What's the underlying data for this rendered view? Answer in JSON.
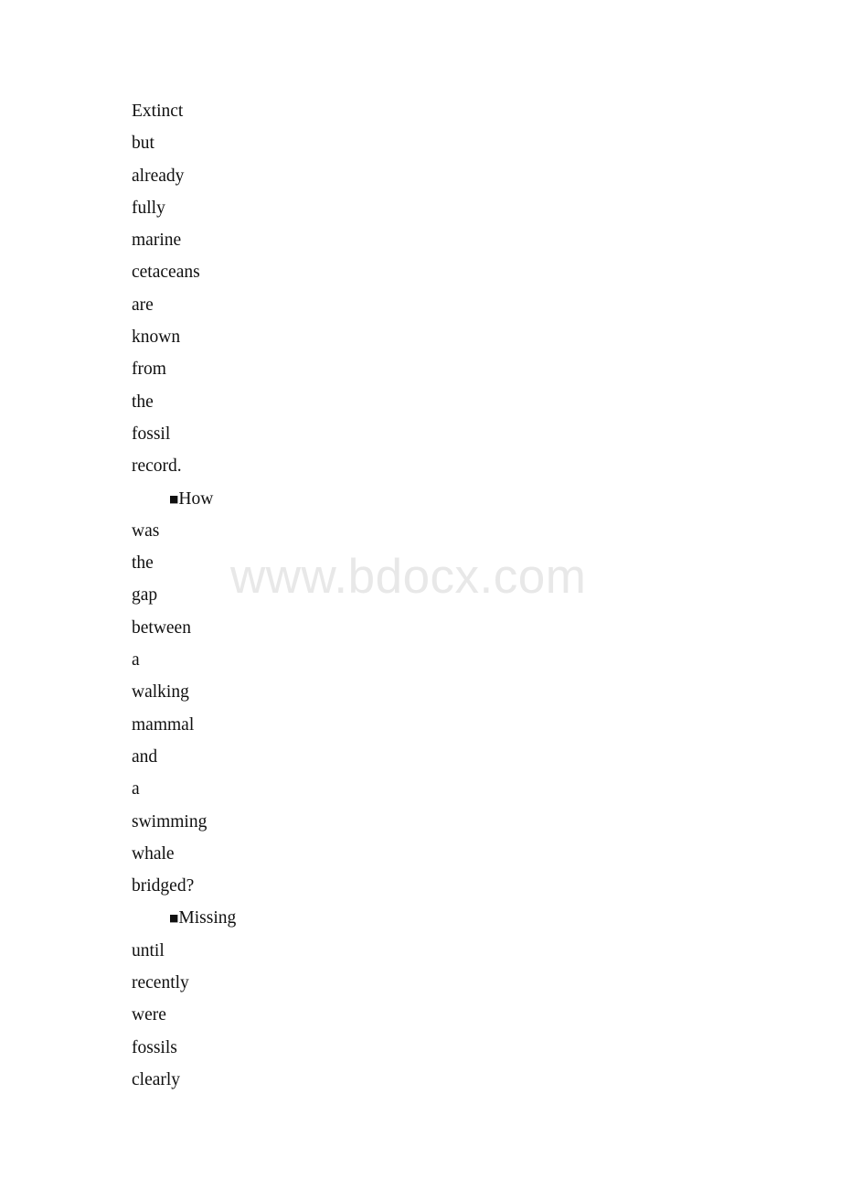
{
  "document": {
    "background_color": "#ffffff",
    "text_color": "#101010",
    "watermark": {
      "text": "www.bdocx.com",
      "color": "#e8e8e8"
    },
    "bullet_glyph": "■",
    "lines": [
      {
        "text": "Extinct",
        "bullet": false
      },
      {
        "text": "but",
        "bullet": false
      },
      {
        "text": "already",
        "bullet": false
      },
      {
        "text": "fully",
        "bullet": false
      },
      {
        "text": "marine",
        "bullet": false
      },
      {
        "text": "cetaceans",
        "bullet": false
      },
      {
        "text": "are",
        "bullet": false
      },
      {
        "text": "known",
        "bullet": false
      },
      {
        "text": "from",
        "bullet": false
      },
      {
        "text": "the",
        "bullet": false
      },
      {
        "text": "fossil",
        "bullet": false
      },
      {
        "text": "record.",
        "bullet": false
      },
      {
        "text": "How",
        "bullet": true
      },
      {
        "text": "was",
        "bullet": false
      },
      {
        "text": "the",
        "bullet": false
      },
      {
        "text": "gap",
        "bullet": false
      },
      {
        "text": "between",
        "bullet": false
      },
      {
        "text": "a",
        "bullet": false
      },
      {
        "text": "walking",
        "bullet": false
      },
      {
        "text": "mammal",
        "bullet": false
      },
      {
        "text": "and",
        "bullet": false
      },
      {
        "text": "a",
        "bullet": false
      },
      {
        "text": "swimming",
        "bullet": false
      },
      {
        "text": "whale",
        "bullet": false
      },
      {
        "text": "bridged?",
        "bullet": false
      },
      {
        "text": "Missing",
        "bullet": true
      },
      {
        "text": "until",
        "bullet": false
      },
      {
        "text": "recently",
        "bullet": false
      },
      {
        "text": "were",
        "bullet": false
      },
      {
        "text": "fossils",
        "bullet": false
      },
      {
        "text": "clearly",
        "bullet": false
      }
    ]
  }
}
